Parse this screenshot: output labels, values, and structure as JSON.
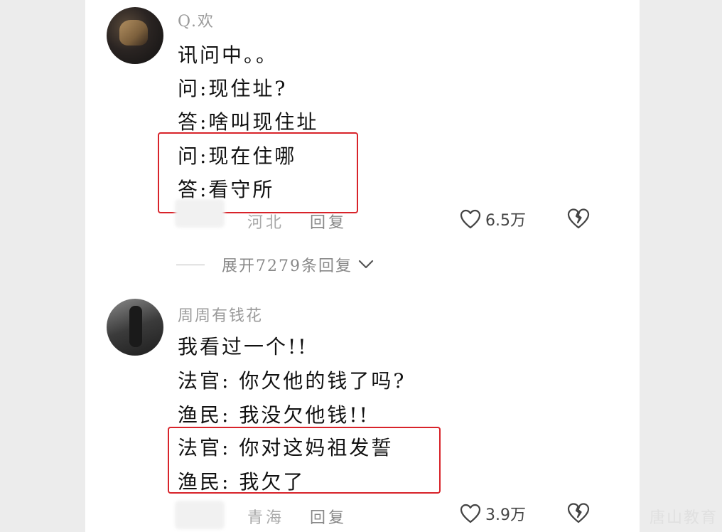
{
  "comments": [
    {
      "username": "Q.欢",
      "lines": [
        "讯问中。。",
        "问:现住址?",
        "答:啥叫现住址",
        "问:现在住哪",
        "答:看守所"
      ],
      "location": "河北",
      "reply_label": "回复",
      "likes": "6.5万",
      "expand_label": "展开7279条回复"
    },
    {
      "username": "周周有钱花",
      "lines": [
        "我看过一个!!",
        "法官: 你欠他的钱了吗?",
        "渔民: 我没欠他钱!!",
        "法官: 你对这妈祖发誓",
        "渔民: 我欠了"
      ],
      "location": "青海",
      "reply_label": "回复",
      "likes": "3.9万"
    }
  ],
  "watermark": "唐山教育",
  "icons": {
    "like": "heart-outline-icon",
    "dislike": "broken-heart-icon",
    "expand": "chevron-down-icon"
  },
  "colors": {
    "highlight_box": "#d8232a",
    "background": "#ececec",
    "panel": "#ffffff"
  }
}
